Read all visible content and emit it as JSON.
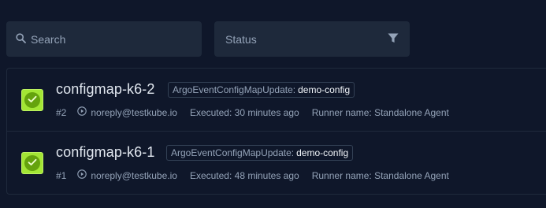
{
  "search": {
    "placeholder": "Search"
  },
  "status_filter": {
    "placeholder": "Status"
  },
  "executions": [
    {
      "name": "configmap-k6-2",
      "label_key": "ArgoEventConfigMapUpdate:",
      "label_value": "demo-config",
      "number": "#2",
      "author": "noreply@testkube.io",
      "executed": "Executed: 30 minutes ago",
      "runner": "Runner name: Standalone Agent",
      "status": "passed"
    },
    {
      "name": "configmap-k6-1",
      "label_key": "ArgoEventConfigMapUpdate:",
      "label_value": "demo-config",
      "number": "#1",
      "author": "noreply@testkube.io",
      "executed": "Executed: 48 minutes ago",
      "runner": "Runner name: Standalone Agent",
      "status": "passed"
    }
  ],
  "colors": {
    "background": "#0f172a",
    "field": "#1e293b",
    "success": "#a3e635"
  }
}
